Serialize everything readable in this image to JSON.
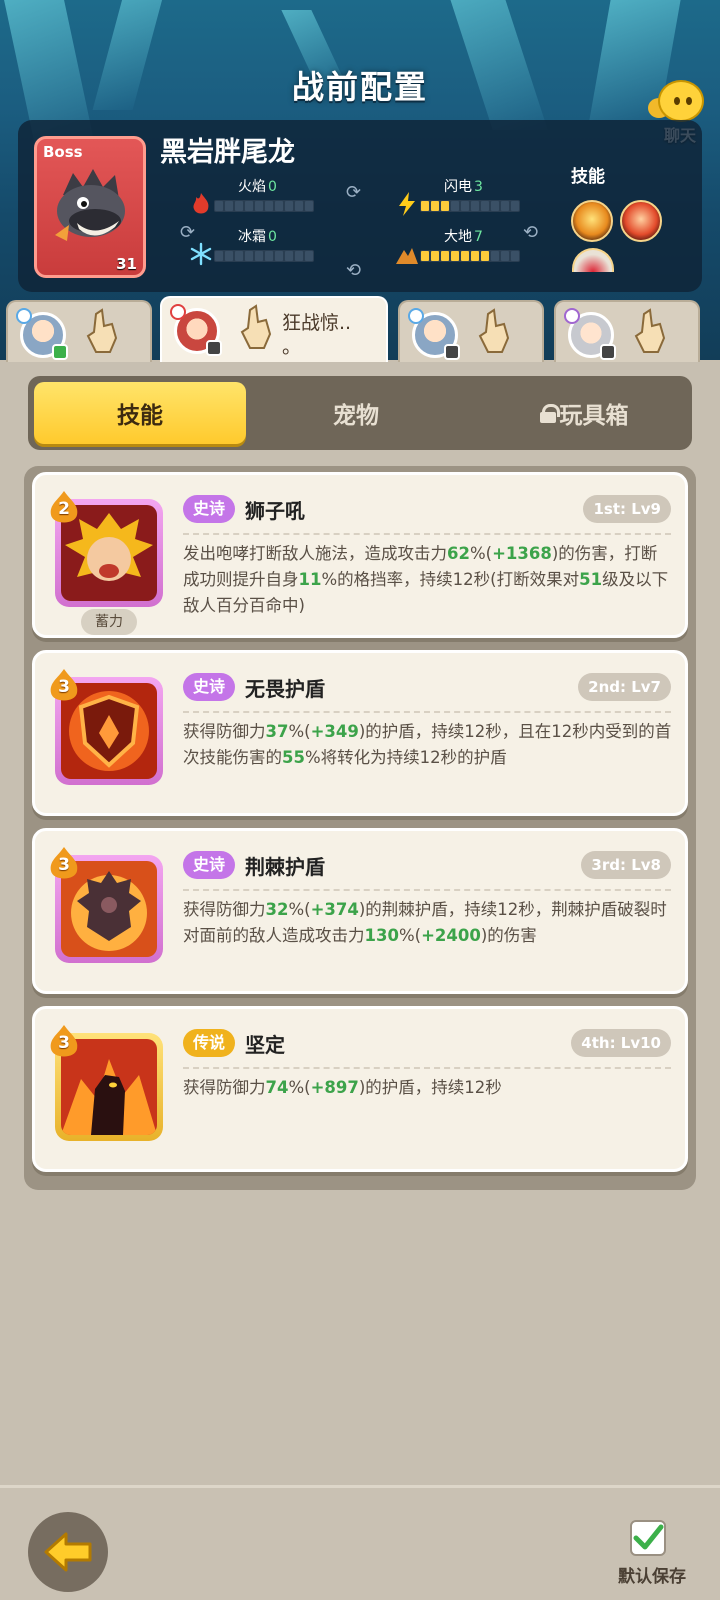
{
  "header": {
    "title": "战前配置",
    "chat_label": "聊天"
  },
  "boss": {
    "tag": "Boss",
    "name": "黑岩胖尾龙",
    "level": "31",
    "stats": [
      {
        "label": "火焰",
        "value": "0",
        "filled": 0
      },
      {
        "label": "闪电",
        "value": "3",
        "filled": 3
      },
      {
        "label": "冰霜",
        "value": "0",
        "filled": 0
      },
      {
        "label": "大地",
        "value": "7",
        "filled": 7
      }
    ],
    "skills_label": "技能"
  },
  "heroes": [
    {
      "skill": ""
    },
    {
      "skill": "狂战惊..",
      "skill_line2": "。"
    },
    {
      "skill": ""
    },
    {
      "skill": ""
    }
  ],
  "tabs": {
    "skills": "技能",
    "pets": "宠物",
    "toybox": "玩具箱"
  },
  "skill_cards": [
    {
      "cost": "2",
      "rarity": "史诗",
      "name": "狮子吼",
      "slot": "1st: Lv9",
      "charge_tag": "蓄力",
      "desc": [
        "发出咆哮打断敌人施法，造成攻击力",
        "62",
        "%(",
        "+1368",
        ")的伤害，打断成功则提升自身",
        "11",
        "%的格挡率，持续12秒(打断效果对",
        "51",
        "级及以下敌人百分百命中)"
      ]
    },
    {
      "cost": "3",
      "rarity": "史诗",
      "name": "无畏护盾",
      "slot": "2nd: Lv7",
      "desc": [
        "获得防御力",
        "37",
        "%(",
        "+349",
        ")的护盾，持续12秒，且在12秒内受到的首次技能伤害的",
        "55",
        "%将转化为持续12秒的护盾"
      ]
    },
    {
      "cost": "3",
      "rarity": "史诗",
      "name": "荆棘护盾",
      "slot": "3rd: Lv8",
      "desc": [
        "获得防御力",
        "32",
        "%(",
        "+374",
        ")的荆棘护盾，持续12秒，荆棘护盾破裂时对面前的敌人造成攻击力",
        "130",
        "%(",
        "+2400",
        ")的伤害"
      ]
    },
    {
      "cost": "3",
      "rarity": "传说",
      "name": "坚定",
      "slot": "4th: Lv10",
      "desc": [
        "获得防御力",
        "74",
        "%(",
        "+897",
        ")的护盾，持续12秒"
      ]
    }
  ],
  "footer": {
    "save_label": "默认保存"
  },
  "colors": {
    "accent_yellow": "#ffca2d",
    "epic": "#c475e8",
    "legend": "#f0b21d",
    "value_green": "#3ca34a"
  }
}
